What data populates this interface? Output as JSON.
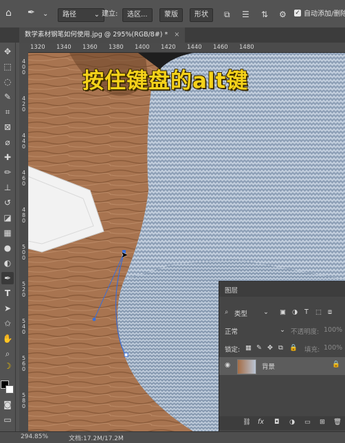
{
  "options_bar": {
    "path_mode": "路径",
    "make_label": "建立:",
    "selection_button": "选区...",
    "mask_button": "蒙版",
    "shape_button": "形状",
    "auto_add_delete": "自动添加/删除"
  },
  "document": {
    "tab_title": "数学素材钢笔如何使用.jpg @ 295%(RGB/8#) *"
  },
  "ruler": {
    "h_ticks": [
      "1320",
      "1340",
      "1360",
      "1380",
      "1400",
      "1420",
      "1440",
      "1460",
      "1480"
    ],
    "v_ticks": [
      "4 0 0",
      "4 2 0",
      "4 4 0",
      "4 6 0",
      "4 8 0",
      "5 0 0",
      "5 2 0",
      "5 4 0",
      "5 6 0",
      "5 8 0"
    ]
  },
  "caption": "按住键盘的alt键",
  "layers_panel": {
    "title": "图层",
    "kind_filter": "类型",
    "blend_mode": "正常",
    "opacity_label": "不透明度:",
    "opacity_value": "100%",
    "lock_label": "锁定:",
    "fill_label": "填充:",
    "fill_value": "100%",
    "layer_name": "背景"
  },
  "status_bar": {
    "zoom": "294.85%",
    "doc_size": "文档:17.2M/17.2M"
  }
}
